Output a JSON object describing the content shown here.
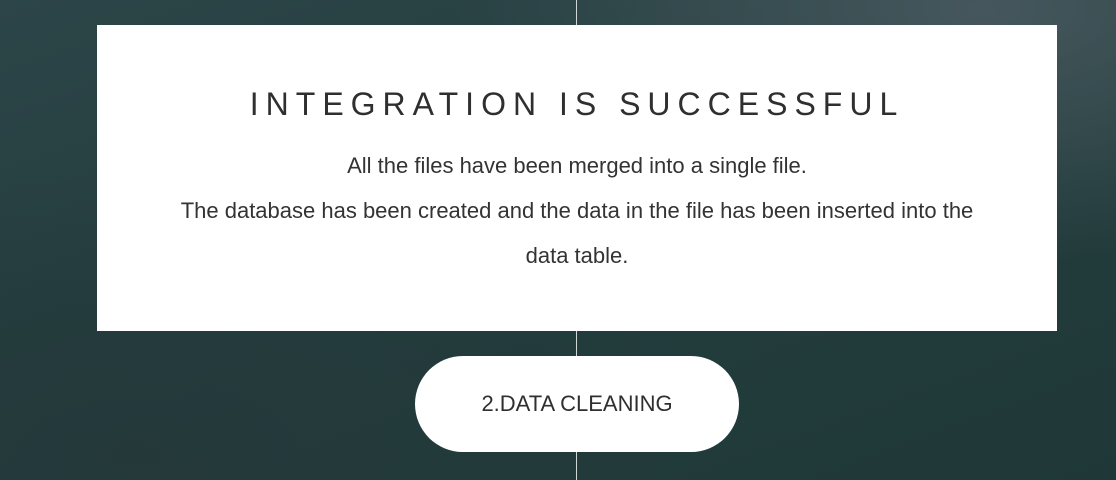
{
  "card": {
    "title": "INTEGRATION IS SUCCESSFUL",
    "line1": "All the files have been merged into a single file.",
    "line2": "The database has been created and the data in the file has been inserted into the data table."
  },
  "actions": {
    "next_step_label": "2.DATA CLEANING"
  },
  "colors": {
    "background": "#243d3e",
    "card": "#ffffff",
    "text": "#333333"
  }
}
